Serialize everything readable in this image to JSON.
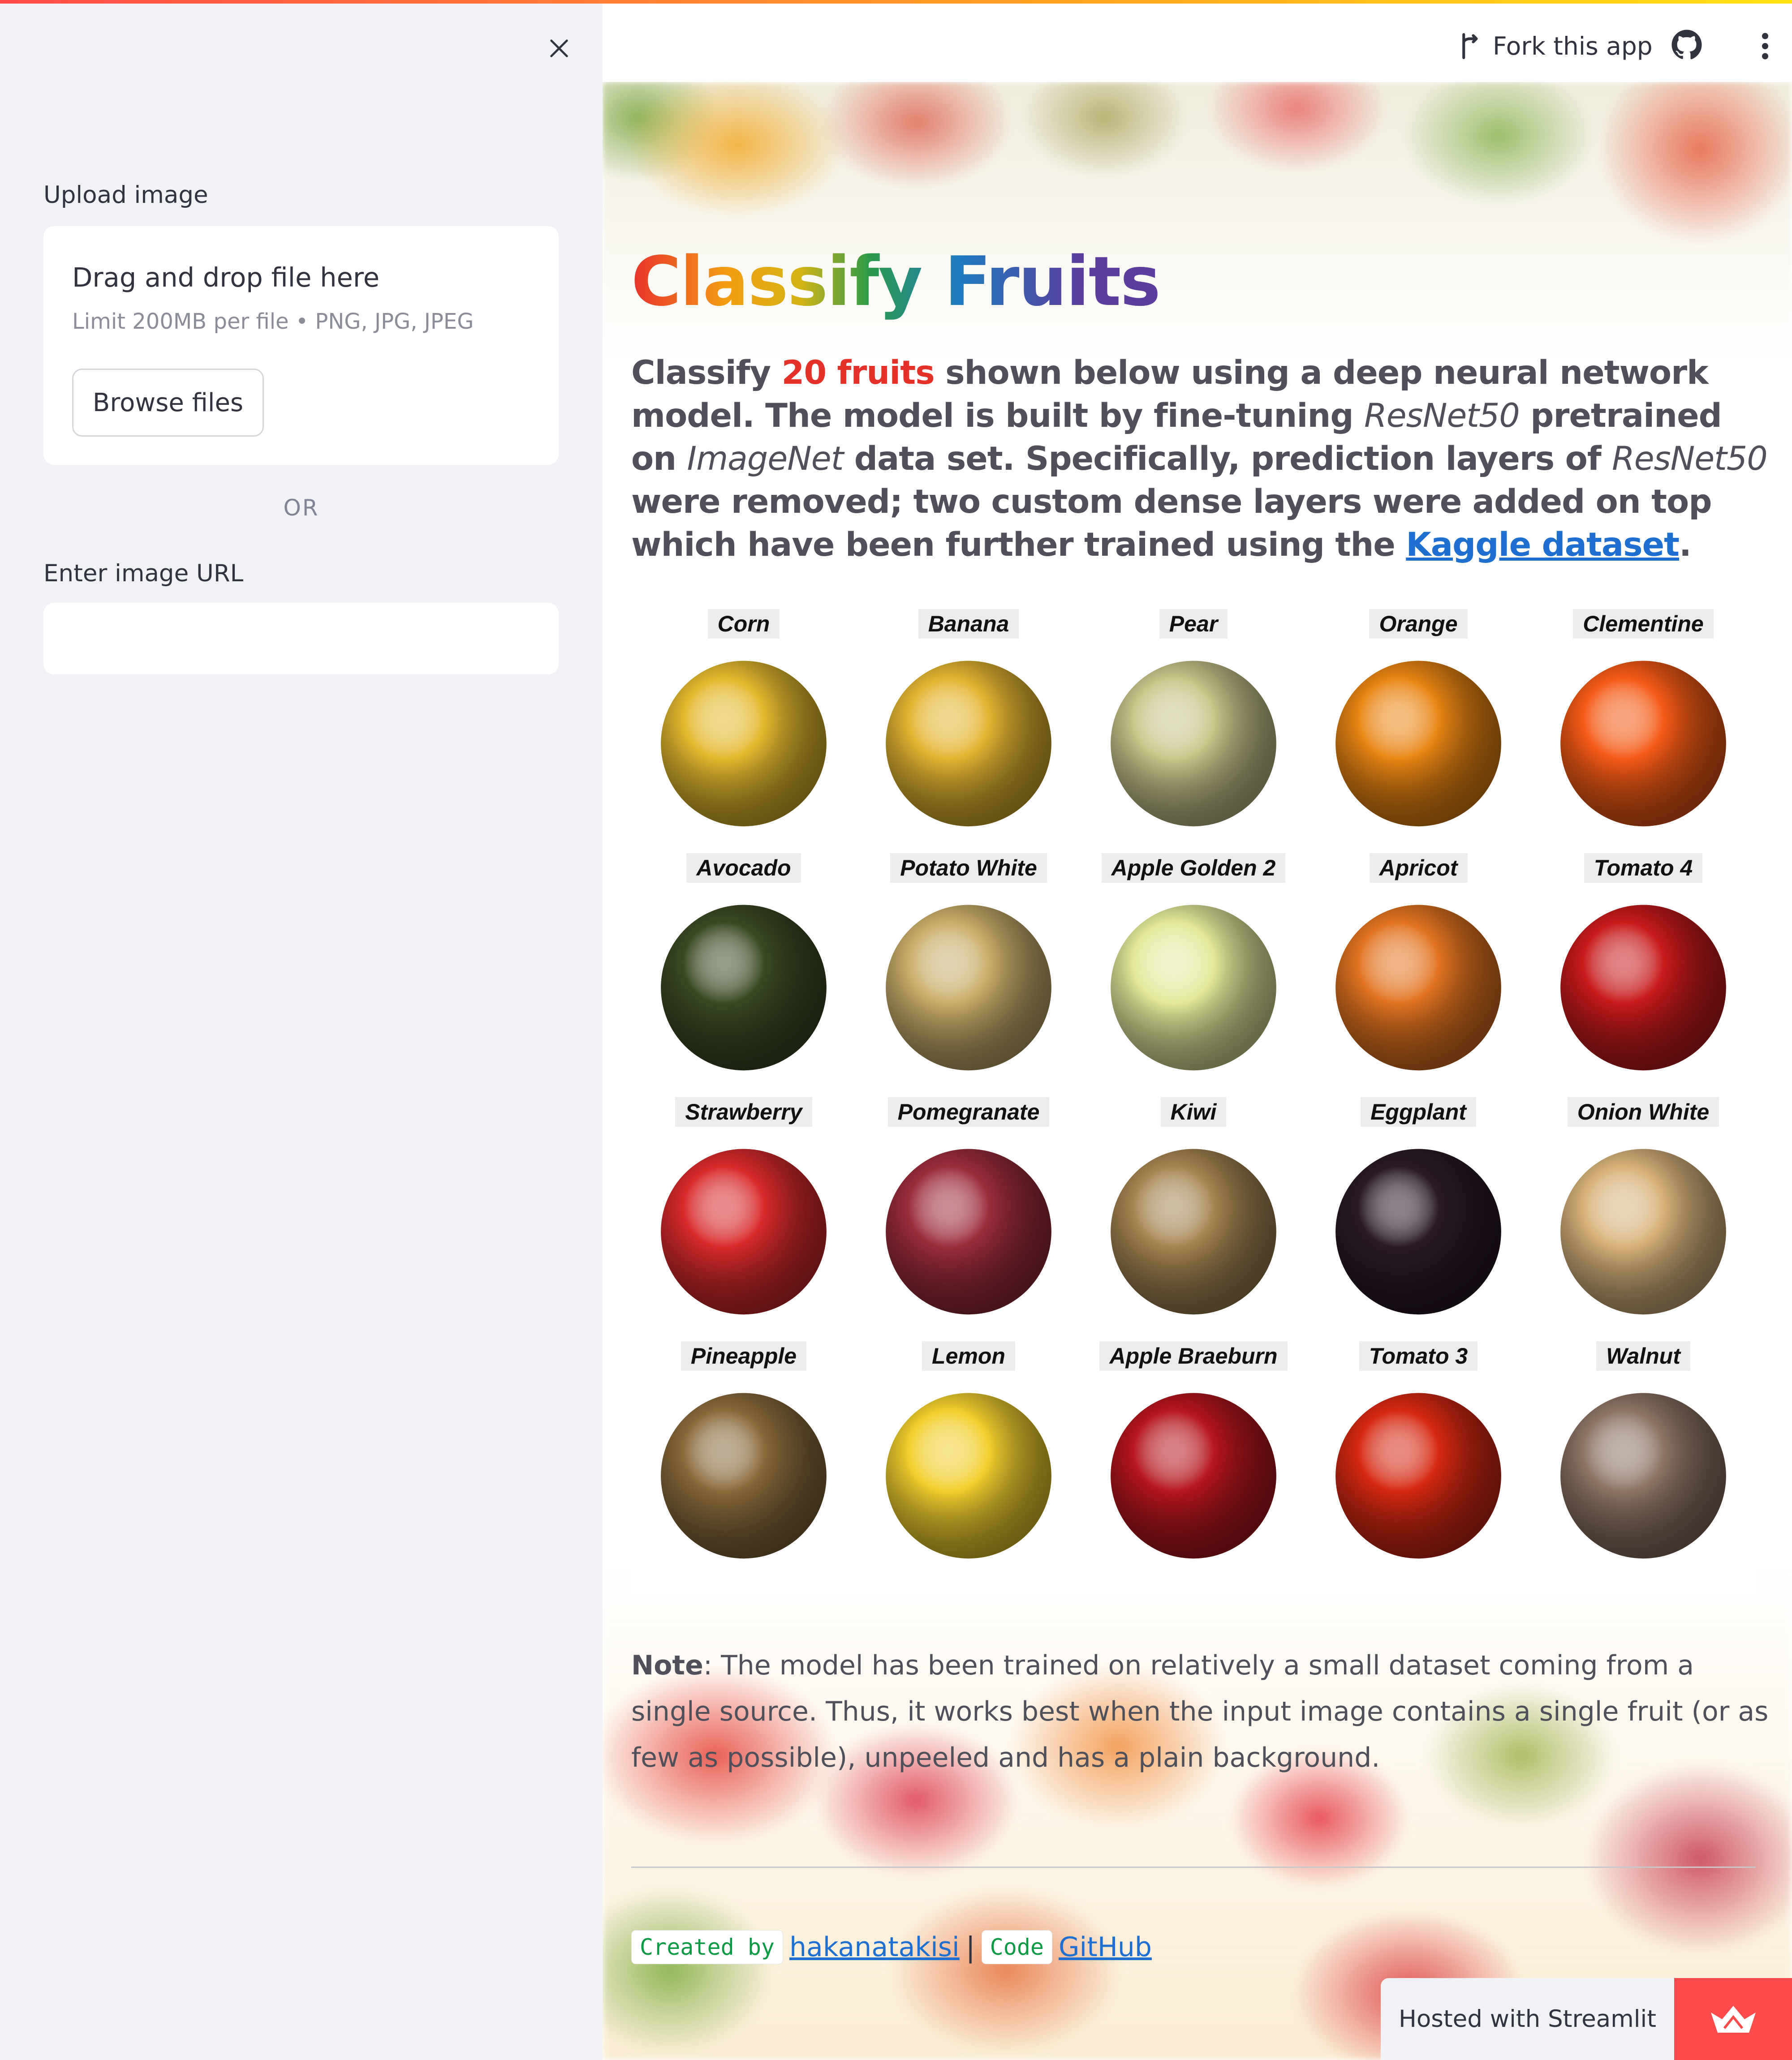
{
  "sidebar": {
    "close_icon": "close-icon",
    "upload_label": "Upload image",
    "drop_title": "Drag and drop file here",
    "drop_limit": "Limit 200MB per file • PNG, JPG, JPEG",
    "browse_label": "Browse files",
    "or_text": "OR",
    "url_label": "Enter image URL",
    "url_value": ""
  },
  "header": {
    "fork_label": "Fork this app",
    "fork_icon": "fork-icon",
    "github_icon": "github-icon",
    "menu_icon": "kebab-menu-icon"
  },
  "main": {
    "title": "Classify Fruits",
    "description": {
      "p1": "Classify ",
      "highlight": "20 fruits",
      "p2": " shown below using a deep neural network model. The model is built by fine-tuning ",
      "em1": "ResNet50",
      "p3": " pretrained on ",
      "em2": "ImageNet",
      "p4": " data set. Specifically, prediction layers of ",
      "em3": "ResNet50",
      "p5": " were removed; two custom dense layers were added on top which have been further trained using the ",
      "link": "Kaggle dataset",
      "p6": "."
    },
    "fruits": [
      {
        "name": "Corn",
        "color": "#e2b92d"
      },
      {
        "name": "Banana",
        "color": "#e2b530"
      },
      {
        "name": "Pear",
        "color": "#c9c68a"
      },
      {
        "name": "Orange",
        "color": "#e98512"
      },
      {
        "name": "Clementine",
        "color": "#f45a16"
      },
      {
        "name": "Avocado",
        "color": "#3b4a22"
      },
      {
        "name": "Potato White",
        "color": "#c9ad6a"
      },
      {
        "name": "Apple Golden 2",
        "color": "#e3e89a"
      },
      {
        "name": "Apricot",
        "color": "#e27320"
      },
      {
        "name": "Tomato 4",
        "color": "#c71a1a"
      },
      {
        "name": "Strawberry",
        "color": "#d82a2a"
      },
      {
        "name": "Pomegranate",
        "color": "#9b2c3a"
      },
      {
        "name": "Kiwi",
        "color": "#a58450"
      },
      {
        "name": "Eggplant",
        "color": "#2a1a26"
      },
      {
        "name": "Onion White",
        "color": "#d7b27a"
      },
      {
        "name": "Pineapple",
        "color": "#8a6a3a"
      },
      {
        "name": "Lemon",
        "color": "#f0cf2d"
      },
      {
        "name": "Apple Braeburn",
        "color": "#b5161c"
      },
      {
        "name": "Tomato 3",
        "color": "#d52812"
      },
      {
        "name": "Walnut",
        "color": "#8d7363"
      }
    ],
    "note": {
      "bold": "Note",
      "text": ": The model has been trained on relatively a small dataset coming from a single source. Thus, it works best when the input image contains a single fruit (or as few as possible), unpeeled and has a plain background."
    },
    "footer": {
      "created_chip": "Created by",
      "author_link": "hakanatakisi",
      "separator": "|",
      "code_chip": "Code",
      "github_link": "GitHub"
    }
  },
  "hosted": {
    "label": "Hosted with Streamlit",
    "logo_icon": "streamlit-crown-icon"
  }
}
